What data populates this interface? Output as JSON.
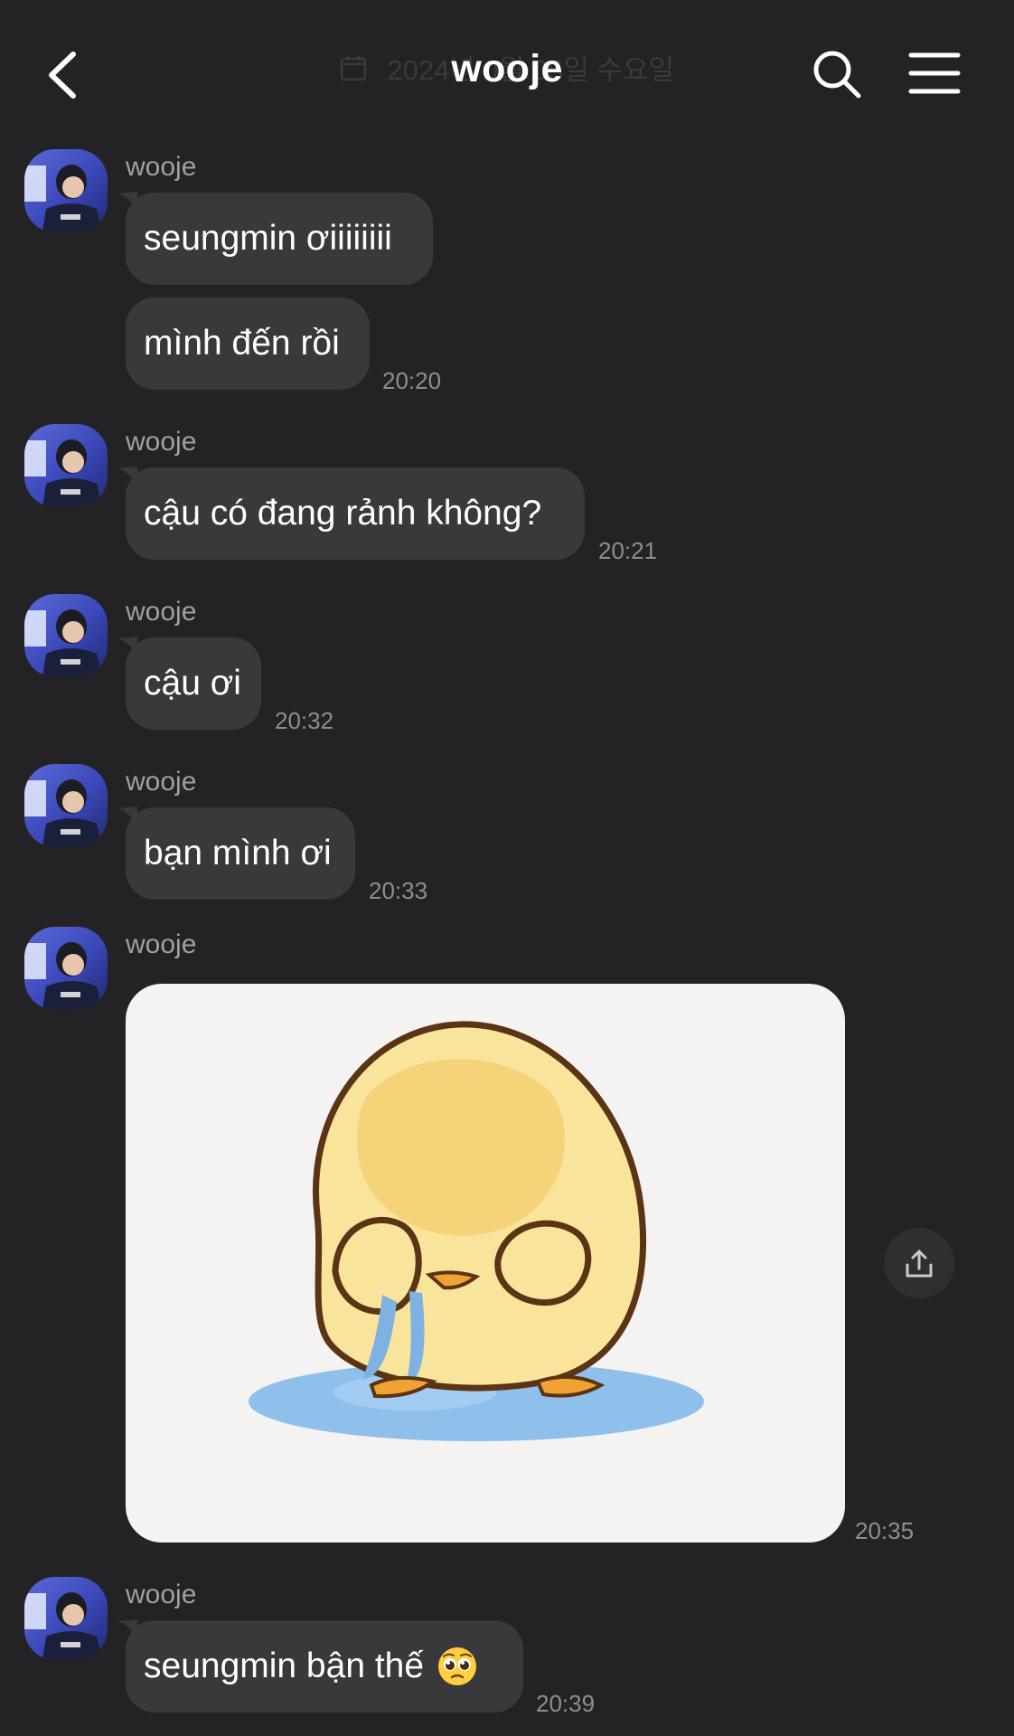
{
  "header": {
    "title": "wooje",
    "date_overlay": "2024년 0월 05일 수요일",
    "icons": {
      "back": "chevron-left-icon",
      "search": "search-icon",
      "menu": "hamburger-menu-icon"
    }
  },
  "colors": {
    "background": "#232325",
    "bubble": "#39393c",
    "sender_text": "#a0a0a3",
    "time_text": "#8e8e91"
  },
  "messages": [
    {
      "sender": "wooje",
      "texts": [
        "seungmin ơiiiiiiii",
        "mình đến rồi"
      ],
      "time": "20:20"
    },
    {
      "sender": "wooje",
      "texts": [
        "cậu có đang rảnh không?"
      ],
      "time": "20:21"
    },
    {
      "sender": "wooje",
      "texts": [
        "cậu ơi"
      ],
      "time": "20:32"
    },
    {
      "sender": "wooje",
      "texts": [
        "bạn mình ơi"
      ],
      "time": "20:33"
    },
    {
      "sender": "wooje",
      "sticker": "crying-duck-sticker",
      "time": "20:35",
      "share_icon": "share-icon"
    },
    {
      "sender": "wooje",
      "texts": [
        "seungmin bận thế"
      ],
      "emoji": "pleading-face-emoji",
      "time": "20:39"
    }
  ]
}
